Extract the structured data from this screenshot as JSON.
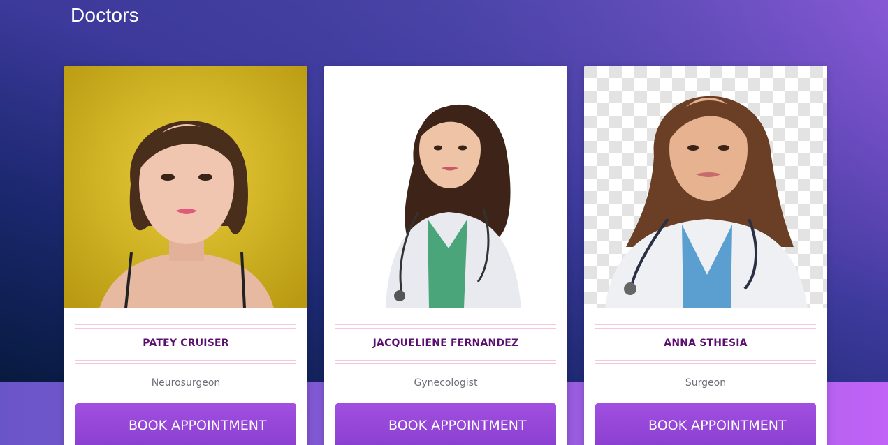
{
  "section": {
    "title": "Doctors"
  },
  "doctors": [
    {
      "name": "PATEY CRUISER",
      "specialty": "Neurosurgeon",
      "button_label": "BOOK APPOINTMENT"
    },
    {
      "name": "JACQUELIENE FERNANDEZ",
      "specialty": "Gynecologist",
      "button_label": "BOOK APPOINTMENT"
    },
    {
      "name": "ANNA STHESIA",
      "specialty": "Surgeon",
      "button_label": "BOOK APPOINTMENT"
    }
  ],
  "colors": {
    "name_text": "#5a0e6e",
    "button": "#9b4ade",
    "divider": "#f7c5dc"
  }
}
